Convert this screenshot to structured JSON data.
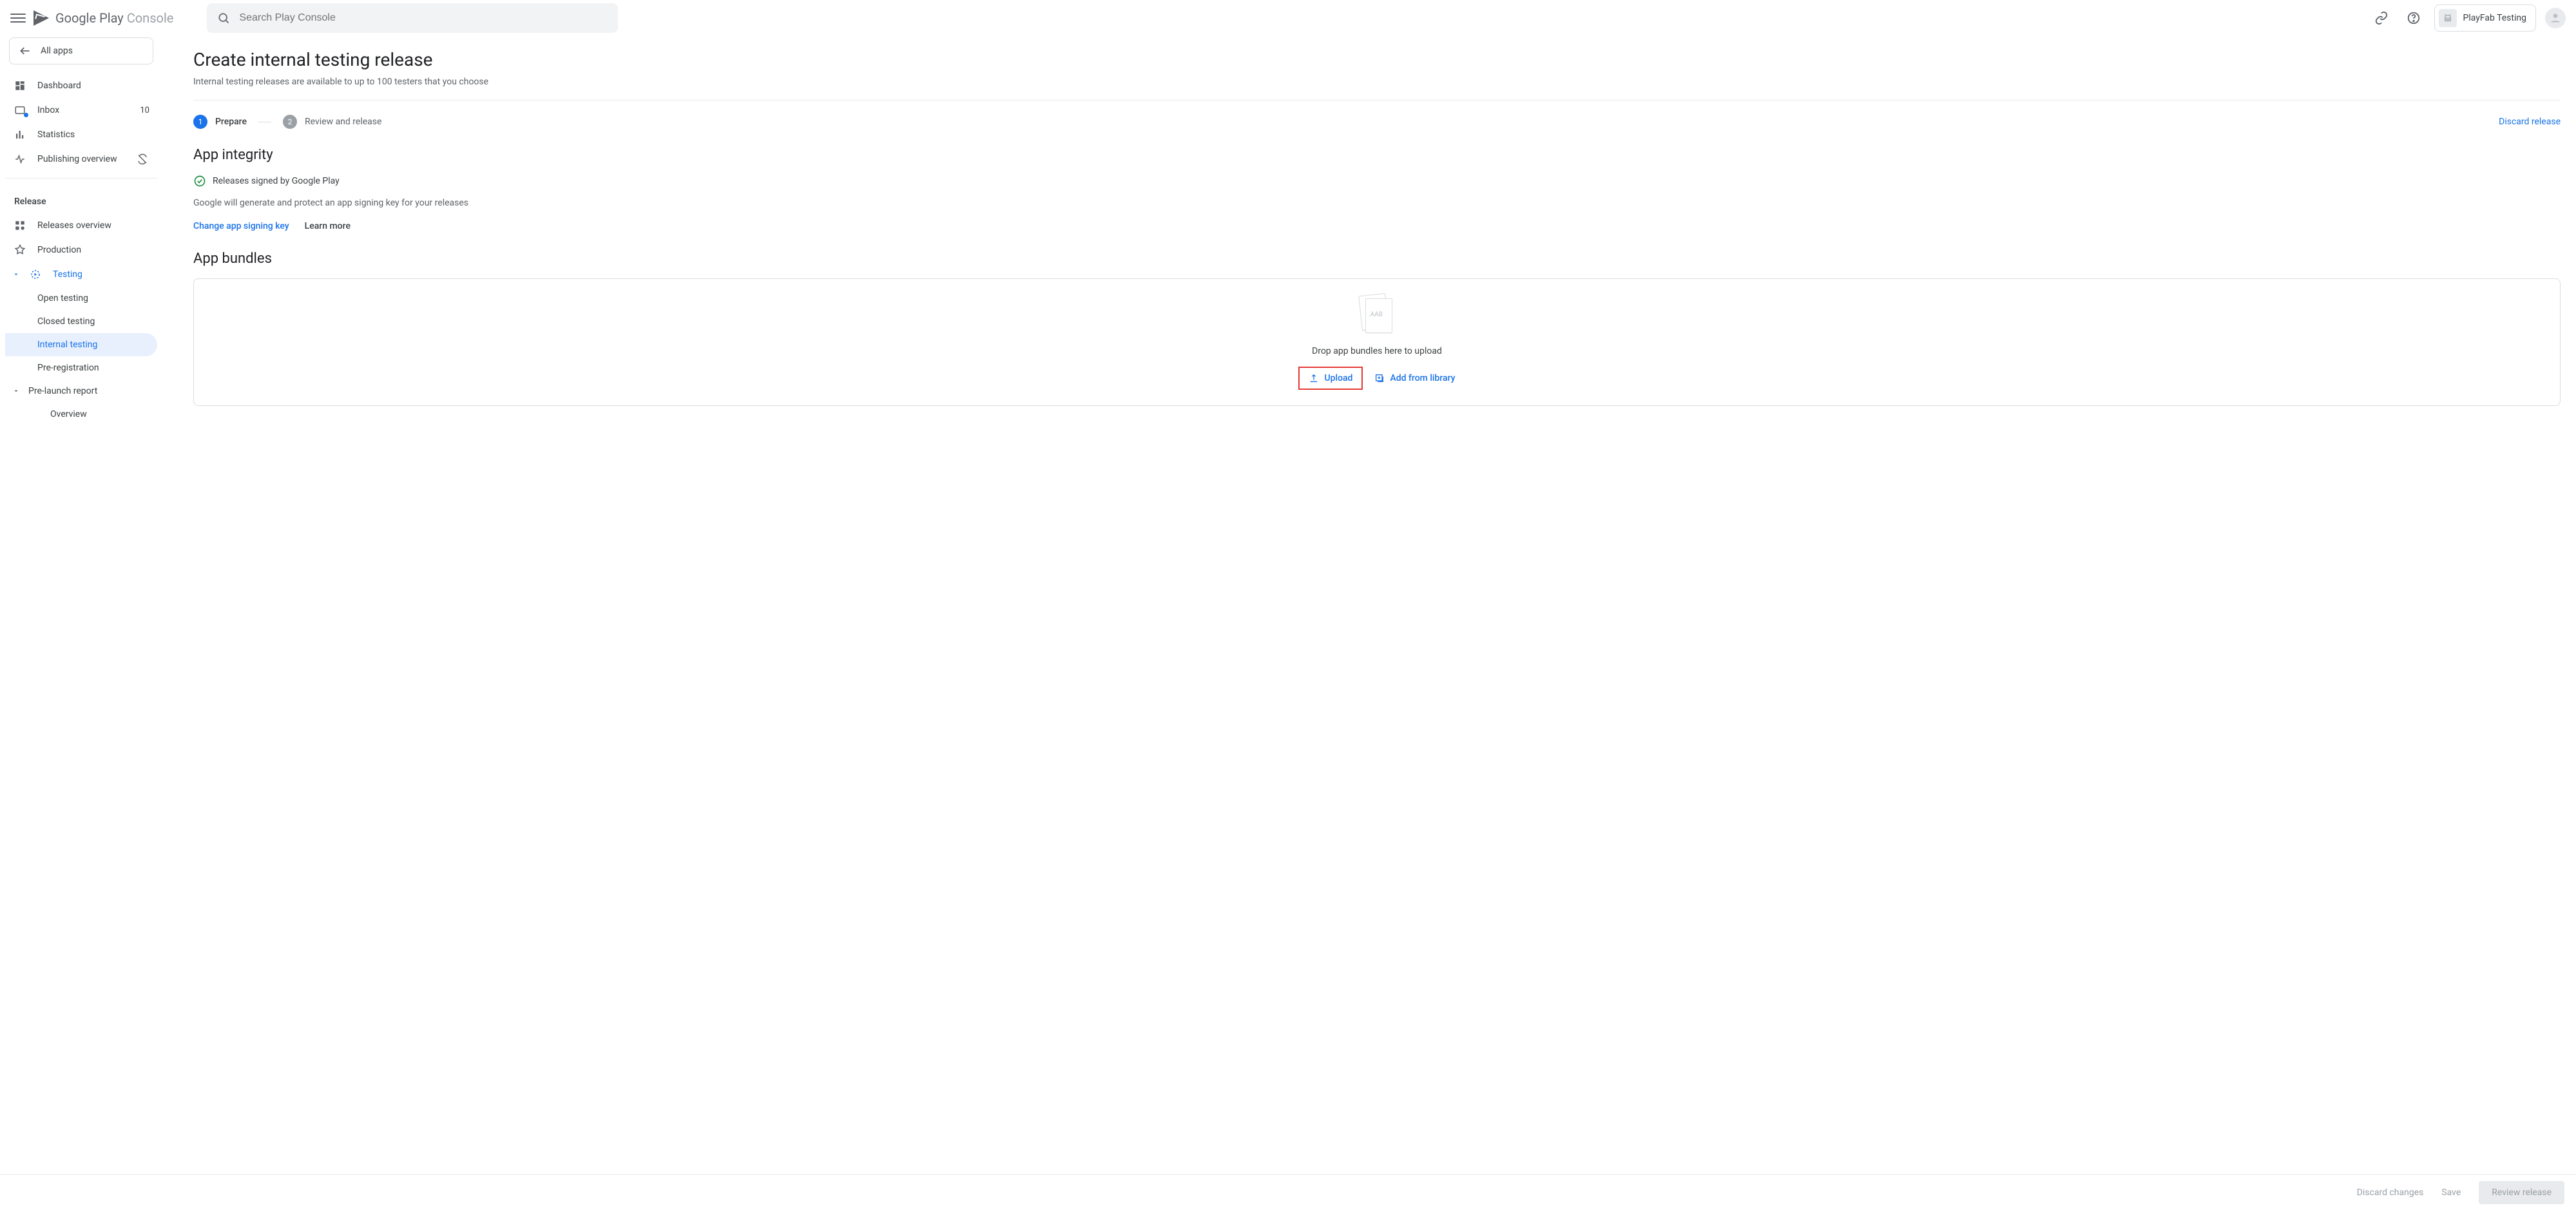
{
  "brand": {
    "name": "Google Play",
    "suffix": "Console"
  },
  "search": {
    "placeholder": "Search Play Console"
  },
  "header": {
    "app_name": "PlayFab Testing"
  },
  "sidebar": {
    "all_apps": "All apps",
    "items": {
      "dashboard": "Dashboard",
      "inbox": "Inbox",
      "inbox_count": "10",
      "statistics": "Statistics",
      "publishing_overview": "Publishing overview"
    },
    "release_label": "Release",
    "release": {
      "releases_overview": "Releases overview",
      "production": "Production",
      "testing": "Testing",
      "open_testing": "Open testing",
      "closed_testing": "Closed testing",
      "internal_testing": "Internal testing",
      "pre_registration": "Pre-registration",
      "pre_launch_report": "Pre-launch report",
      "overview": "Overview"
    }
  },
  "page": {
    "title": "Create internal testing release",
    "subtitle": "Internal testing releases are available to up to 100 testers that you choose",
    "steps": {
      "one": "1",
      "one_label": "Prepare",
      "two": "2",
      "two_label": "Review and release"
    },
    "discard": "Discard release",
    "integrity": {
      "heading": "App integrity",
      "signed": "Releases signed by Google Play",
      "desc": "Google will generate and protect an app signing key for your releases",
      "change": "Change app signing key",
      "learn": "Learn more"
    },
    "bundles": {
      "heading": "App bundles",
      "aab": ".AAB",
      "drop": "Drop app bundles here to upload",
      "upload": "Upload",
      "library": "Add from library"
    }
  },
  "footer": {
    "discard": "Discard changes",
    "save": "Save",
    "review": "Review release"
  }
}
